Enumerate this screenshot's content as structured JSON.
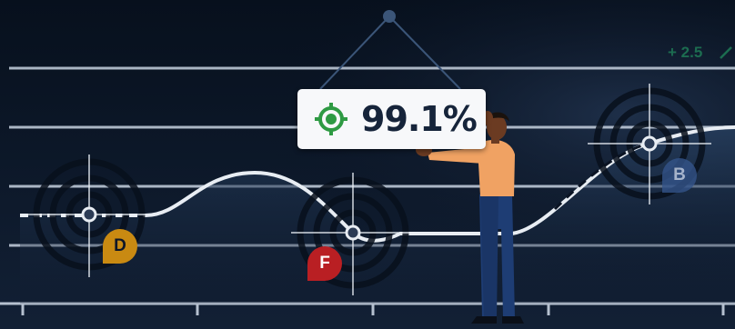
{
  "score": {
    "value": "99.1%",
    "icon": "target-icon",
    "icon_color": "#2e9a43"
  },
  "delta": {
    "text": "+ 2.5",
    "icon": "trend-up-icon",
    "color": "#1f7a56"
  },
  "markers": [
    {
      "letter": "D",
      "color": "#c98a12"
    },
    {
      "letter": "F",
      "color": "#b91f23"
    },
    {
      "letter": "B",
      "color": "#34548a"
    }
  ],
  "colors": {
    "background": "#0b1424",
    "gridlines": "#c7d2e0",
    "curve": "#e8edf3",
    "card": "#f7f8fa"
  }
}
